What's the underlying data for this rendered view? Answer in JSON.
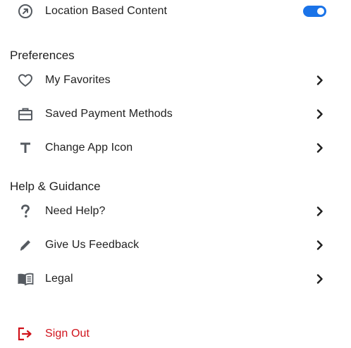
{
  "location": {
    "label": "Location Based Content",
    "toggle_on": true
  },
  "preferences": {
    "title": "Preferences",
    "items": [
      {
        "label": "My Favorites",
        "icon": "heart-icon"
      },
      {
        "label": "Saved Payment Methods",
        "icon": "briefcase-icon"
      },
      {
        "label": "Change App Icon",
        "icon": "text-t-icon"
      }
    ]
  },
  "help": {
    "title": "Help & Guidance",
    "items": [
      {
        "label": "Need Help?",
        "icon": "question-icon"
      },
      {
        "label": "Give Us Feedback",
        "icon": "pencil-icon"
      },
      {
        "label": "Legal",
        "icon": "book-icon"
      }
    ]
  },
  "signout": {
    "label": "Sign Out",
    "icon": "sign-out-icon",
    "color": "#d0121b"
  },
  "colors": {
    "accent": "#1a73e8",
    "danger": "#d0121b",
    "icon": "#555a60"
  }
}
